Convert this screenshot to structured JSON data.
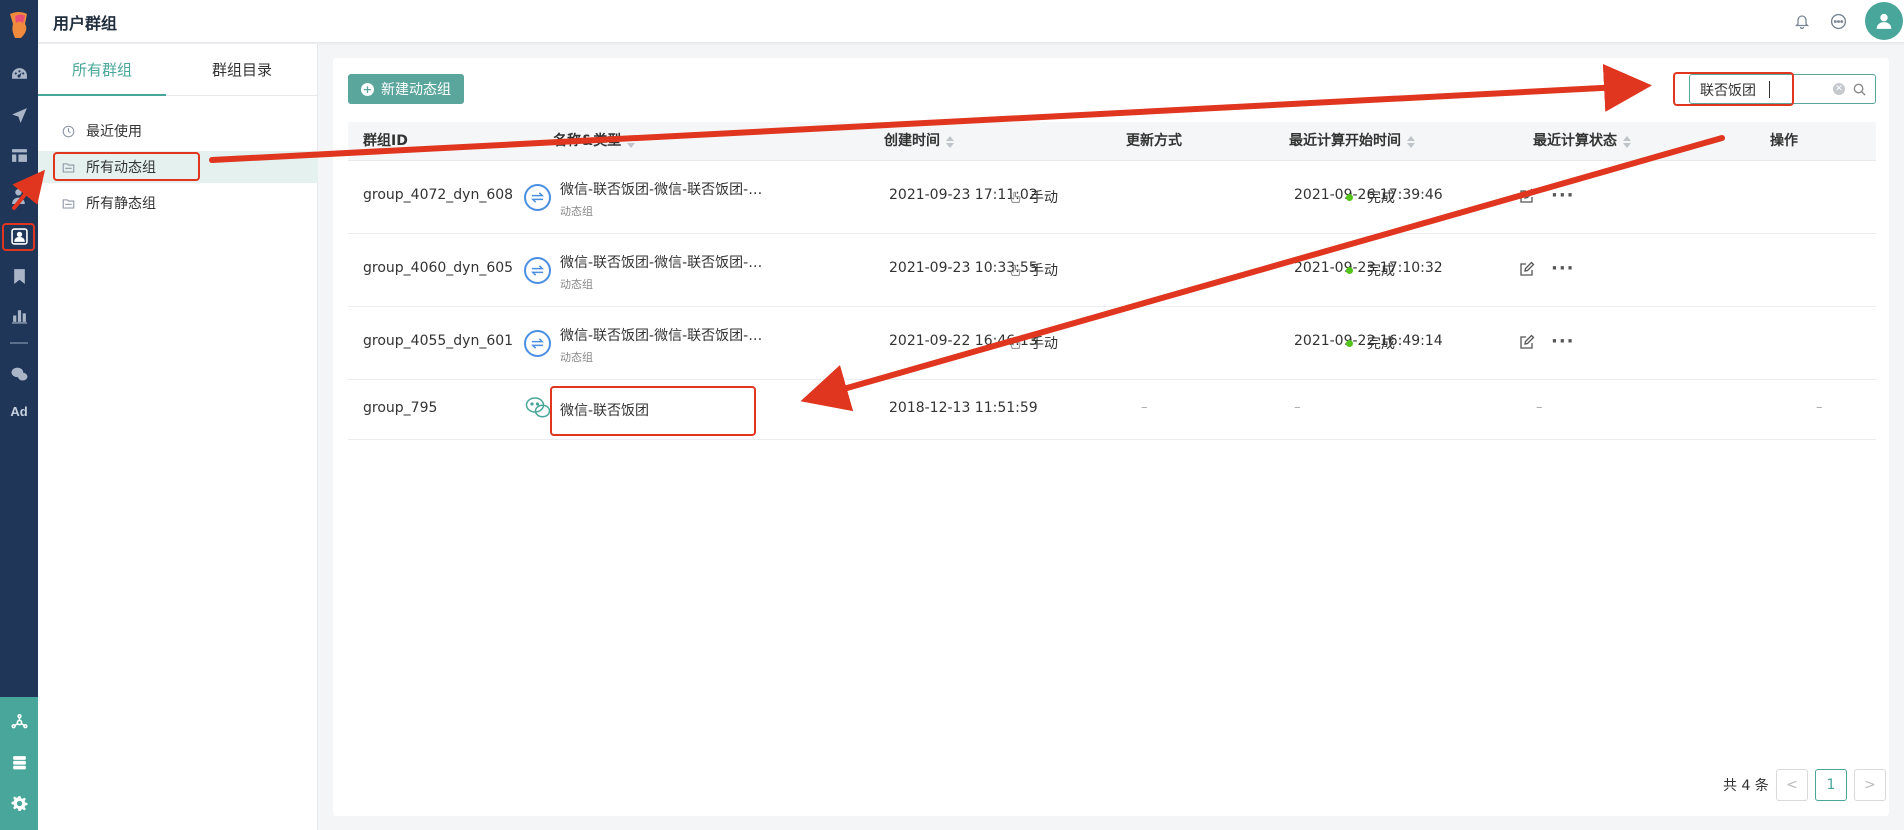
{
  "app": {
    "title": "用户群组"
  },
  "colors": {
    "accent": "#49a69a",
    "rail": "#1f3658",
    "annotation": "#e0351f",
    "status_done": "#52c41a"
  },
  "rail": {
    "items": [
      "dashboard-icon",
      "send-icon",
      "layout-icon",
      "user-tag-icon",
      "user-group-icon",
      "bookmark-icon",
      "bar-chart-icon",
      "wechat-icon",
      "ad-label"
    ],
    "ad_label": "Ad",
    "bottom_items": [
      "network-icon",
      "database-icon",
      "gear-icon"
    ]
  },
  "sidebar": {
    "tabs": [
      {
        "label": "所有群组",
        "active": true
      },
      {
        "label": "群组目录",
        "active": false
      }
    ],
    "items": [
      {
        "label": "最近使用",
        "icon": "clock-icon"
      },
      {
        "label": "所有动态组",
        "icon": "folder-icon",
        "active": true
      },
      {
        "label": "所有静态组",
        "icon": "folder-icon"
      }
    ]
  },
  "toolbar": {
    "new_button": "新建动态组",
    "search_value": "联否饭团"
  },
  "table": {
    "columns": [
      "群组ID",
      "名称&类型",
      "创建时间",
      "更新方式",
      "最近计算开始时间",
      "最近计算状态",
      "操作"
    ],
    "rows": [
      {
        "id": "group_4072_dyn_608",
        "name": "微信-联否饭团-微信-联否饭团-微信-联否饭团",
        "type": "动态组",
        "created": "2021-09-23 17:11:02",
        "update": "手动",
        "calc_start": "2021-09-26 17:39:46",
        "status": "完成"
      },
      {
        "id": "group_4060_dyn_605",
        "name": "微信-联否饭团-微信-联否饭团-微信-联否饭团",
        "type": "动态组",
        "created": "2021-09-23 10:33:55",
        "update": "手动",
        "calc_start": "2021-09-23 17:10:32",
        "status": "完成"
      },
      {
        "id": "group_4055_dyn_601",
        "name": "微信-联否饭团-微信-联否饭团-微信-联否饭团",
        "type": "动态组",
        "created": "2021-09-22 16:46:13",
        "update": "手动",
        "calc_start": "2021-09-22 16:49:14",
        "status": "完成"
      },
      {
        "id": "group_795",
        "name": "微信-联否饭团",
        "type": "",
        "created": "2018-12-13 11:51:59",
        "update": "–",
        "calc_start": "–",
        "status": "–"
      }
    ],
    "empty_dash": "–"
  },
  "pagination": {
    "total": "共 4 条",
    "current": "1",
    "prev": "<",
    "next": ">"
  }
}
